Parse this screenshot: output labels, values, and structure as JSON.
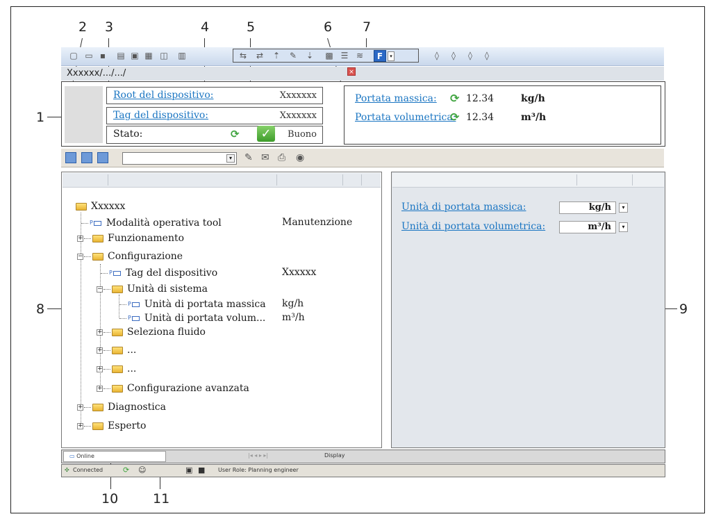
{
  "callouts": [
    "1",
    "2",
    "3",
    "4",
    "5",
    "6",
    "7",
    "8",
    "9",
    "10",
    "11"
  ],
  "breadcrumb": "Xxxxxx/.../.../",
  "header": {
    "root_label": "Root del dispositivo:",
    "root_value": "Xxxxxxx",
    "tag_label": "Tag del dispositivo:",
    "tag_value": "Xxxxxxx",
    "status_label": "Stato:",
    "status_value": "Buono",
    "mass_label": "Portata massica:",
    "mass_value": "12.34",
    "mass_unit": "kg/h",
    "vol_label": "Portata volumetrica:",
    "vol_value": "12.34",
    "vol_unit": "m³/h"
  },
  "toolbar_f": "F",
  "tree": {
    "root": "Xxxxxx",
    "mode_label": "Modalità operativa tool",
    "mode_value": "Manutenzione",
    "funz": "Funzionamento",
    "config": "Configurazione",
    "tag": "Tag del dispositivo",
    "tag_value": "Xxxxxx",
    "unit_sys": "Unità di sistema",
    "mass_unit": "Unità di portata massica",
    "mass_unit_value": "kg/h",
    "vol_unit": "Unità di portata volum...",
    "vol_unit_value": "m³/h",
    "fluid": "Seleziona fluido",
    "dots1": "...",
    "dots2": "...",
    "advanced": "Configurazione avanzata",
    "diag": "Diagnostica",
    "expert": "Esperto"
  },
  "right": {
    "mass_link": "Unità di portata massica:",
    "mass_value": "kg/h",
    "vol_link": "Unità di portata volumetrica:",
    "vol_value": "m³/h"
  },
  "status_bar": {
    "online": "Online",
    "display": "Display",
    "connected": "Connected",
    "user_role": "User Role: Planning engineer"
  }
}
